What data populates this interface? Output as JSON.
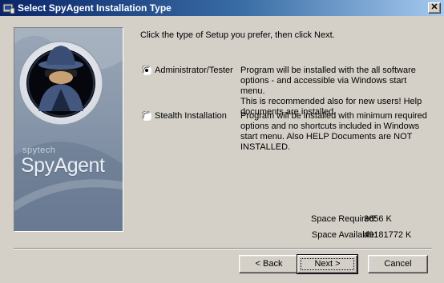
{
  "window": {
    "title": "Select SpyAgent Installation Type",
    "close_symbol": "✕"
  },
  "banner": {
    "brand_small": "spytech",
    "brand_large": "SpyAgent"
  },
  "main": {
    "prompt": "Click the type of Setup you prefer, then click Next.",
    "options": [
      {
        "label": "Administrator/Tester",
        "selected": true,
        "desc": [
          "Program will be installed with the all software",
          "options - and accessible via Windows start menu.",
          "This is recommended also for new users! Help",
          "documents are installed."
        ]
      },
      {
        "label": "Stealth Installation",
        "selected": false,
        "desc": [
          "Program will be installed with minimum required",
          "options and no shortcuts included in Windows",
          "start menu. Also HELP Documents are NOT",
          "INSTALLED."
        ]
      }
    ],
    "space_required_label": "Space Required:",
    "space_required_value": "3656 K",
    "space_available_label": "Space Available:",
    "space_available_value": "49181772 K"
  },
  "buttons": {
    "back": "< Back",
    "next": "Next >",
    "cancel": "Cancel"
  },
  "colors": {
    "titlebar": "#0a246a",
    "face": "#d4d0c8"
  }
}
